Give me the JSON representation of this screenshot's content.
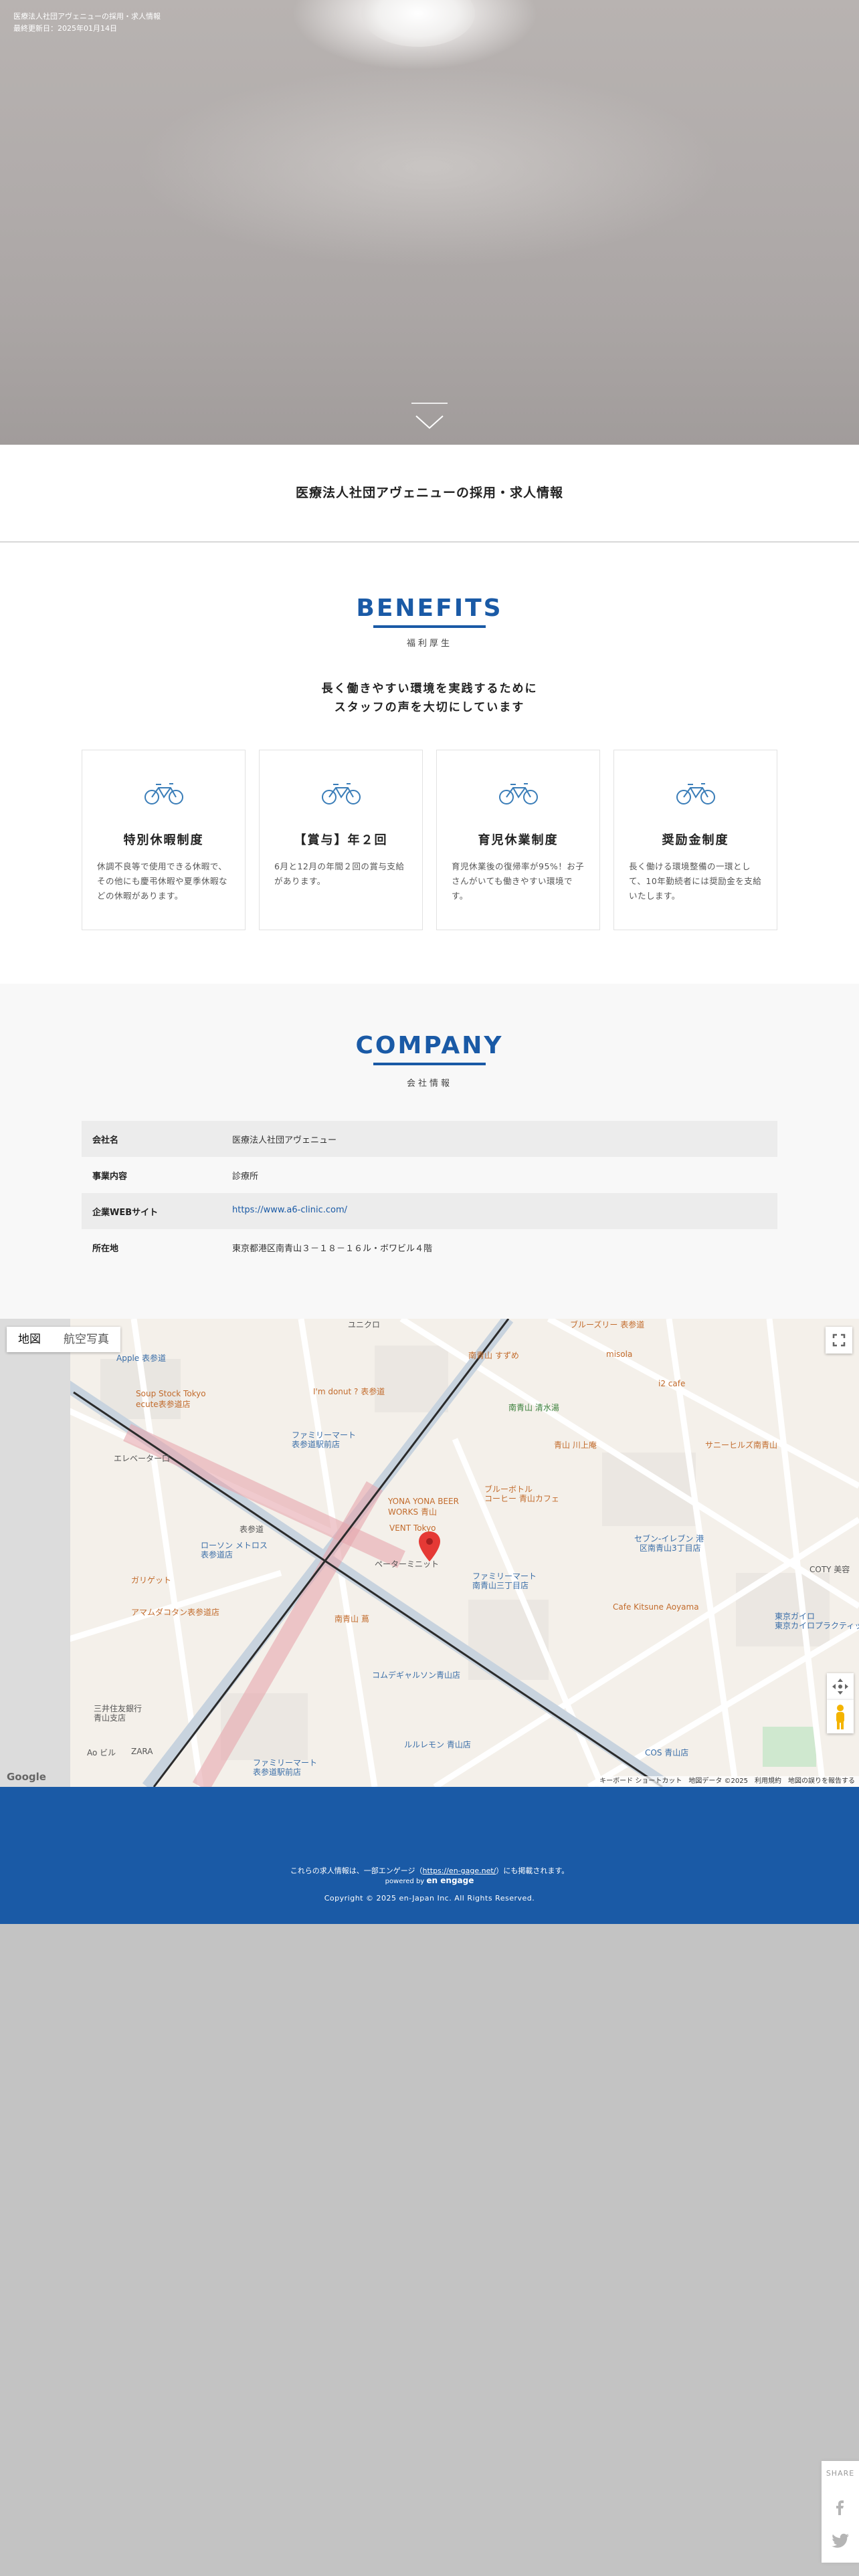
{
  "hero": {
    "site_title": "医療法人社団アヴェニューの採用・求人情報",
    "updated_label": "最終更新日：",
    "updated_date": "2025年01月14日"
  },
  "title_strip": {
    "title": "医療法人社団アヴェニューの採用・求人情報"
  },
  "benefits": {
    "heading": "BENEFITS",
    "sub": "福利厚生",
    "lead_line1": "長く働きやすい環境を実践するために",
    "lead_line2": "スタッフの声を大切にしています",
    "cards": [
      {
        "icon": "bicycle-icon",
        "title": "特別休暇制度",
        "text": "休調不良等で使用できる休暇で、その他にも慶弔休暇や夏季休暇などの休暇があります。"
      },
      {
        "icon": "bicycle-icon",
        "title": "【賞与】年２回",
        "text": "6月と12月の年間２回の賞与支給があります。"
      },
      {
        "icon": "bicycle-icon",
        "title": "育児休業制度",
        "text": "育児休業後の復帰率が95%！お子さんがいても働きやすい環境です。"
      },
      {
        "icon": "bicycle-icon",
        "title": "奨励金制度",
        "text": "長く働ける環境整備の一環として、10年勤続者には奨励金を支給いたします。"
      }
    ]
  },
  "company": {
    "heading": "COMPANY",
    "sub": "会社情報",
    "rows": [
      {
        "key": "会社名",
        "value": "医療法人社団アヴェニュー"
      },
      {
        "key": "事業内容",
        "value": "診療所"
      },
      {
        "key": "企業WEBサイト",
        "value": "https://www.a6-clinic.com/"
      },
      {
        "key": "所在地",
        "value": "東京都港区南青山３－１８－１６ル・ボワビル４階"
      }
    ]
  },
  "map": {
    "tab_map": "地図",
    "tab_satellite": "航空写真",
    "google": "Google",
    "attribution": "キーボード ショートカット　地図データ ©2025　利用規約　地図の誤りを報告する",
    "labels": [
      "Apple 表参道",
      "Soup Stock Tokyo",
      "ecute表参道店",
      "エレベーター口",
      "I'm donut ? 表参道",
      "ファミリーマート",
      "表参道駅前店",
      "表参道",
      "ローソン メトロス",
      "表参道店",
      "YONA YONA BEER",
      "WORKS 青山",
      "VENT Tokyo",
      "ブルーボトル",
      "コーヒー 青山カフェ",
      "ペーターミニット",
      "ファミリーマート",
      "南青山三丁目店",
      "セブン-イレブン 港",
      "区南青山3丁目店",
      "Cafe Kitsune Aoyama",
      "南青山 清水湯",
      "青山 川上庵",
      "ブルーズリー 表参道",
      "ユニクロ",
      "アマムダコタン表参道店",
      "ガリゲット",
      "ルルレモン 青山店",
      "COS 青山店",
      "ファミリーマート",
      "表参道駅前店",
      "コムデギャルソン青山店",
      "三井住友銀行",
      "青山支店",
      "Ao ビル",
      "ZARA",
      "東京ガイロ",
      "南青山 蔦",
      "misola",
      "i2 cafe",
      "COTY 美容",
      "東京カイロプラクティック",
      "南青山 すずめ",
      "サニーヒルズ南青山"
    ]
  },
  "footer": {
    "line1_pre": "これらの求人情報は、一部エンゲージ（",
    "line1_link": "https://en-gage.net/",
    "line1_post": "）にも掲載されます。",
    "powered_by": "powered by",
    "brand": "en engage",
    "copyright": "Copyright © 2025 en-Japan Inc. All Rights Reserved."
  },
  "share": {
    "label": "SHARE"
  }
}
